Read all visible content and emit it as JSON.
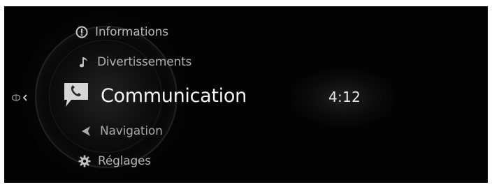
{
  "menu": {
    "items": [
      {
        "label": "Informations",
        "icon": "info-icon"
      },
      {
        "label": "Divertissements",
        "icon": "music-note-icon"
      },
      {
        "label": "Communication",
        "icon": "phone-icon",
        "selected": true
      },
      {
        "label": "Navigation",
        "icon": "navigation-arrow-icon"
      },
      {
        "label": "Réglages",
        "icon": "gear-icon"
      }
    ]
  },
  "call": {
    "duration": "4:12"
  },
  "colors": {
    "background": "#030303",
    "selected_text": "#f4f4f4",
    "unselected_text": "#b5b5b5"
  }
}
